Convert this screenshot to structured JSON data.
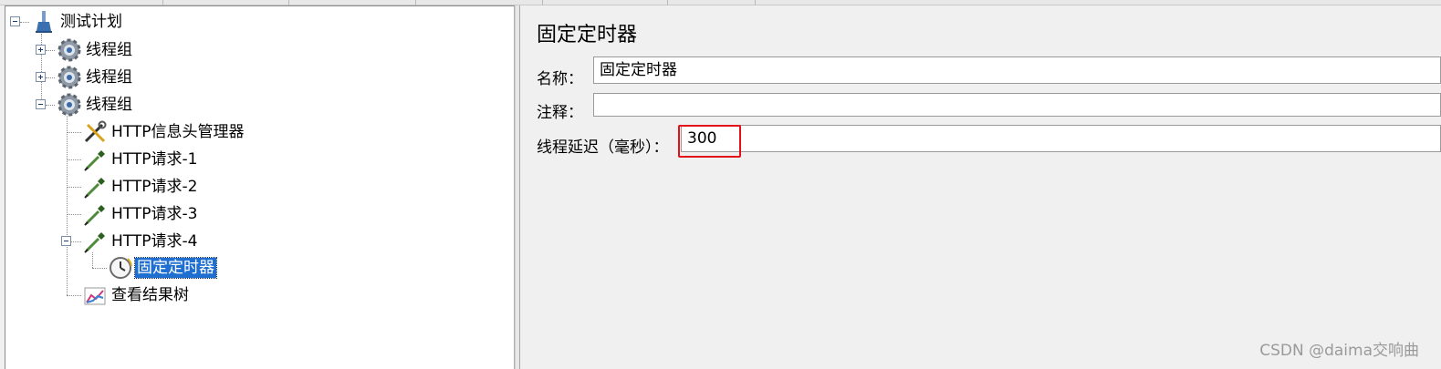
{
  "tree": {
    "root": {
      "label": "测试计划",
      "icon": "test-plan-icon"
    },
    "nodes": [
      {
        "label": "线程组",
        "icon": "gear-icon"
      },
      {
        "label": "线程组",
        "icon": "gear-icon"
      },
      {
        "label": "线程组",
        "icon": "gear-icon"
      },
      {
        "label": "HTTP信息头管理器",
        "icon": "tools-icon"
      },
      {
        "label": "HTTP请求-1",
        "icon": "pipette-icon"
      },
      {
        "label": "HTTP请求-2",
        "icon": "pipette-icon"
      },
      {
        "label": "HTTP请求-3",
        "icon": "pipette-icon"
      },
      {
        "label": "HTTP请求-4",
        "icon": "pipette-icon"
      },
      {
        "label": "固定定时器",
        "icon": "timer-icon"
      },
      {
        "label": "查看结果树",
        "icon": "chart-icon"
      }
    ]
  },
  "panel": {
    "title": "固定定时器",
    "name_label": "名称：",
    "name_value": "固定定时器",
    "comment_label": "注释：",
    "comment_value": "",
    "delay_label": "线程延迟（毫秒）：",
    "delay_value": "300"
  },
  "watermark": "CSDN @daima交响曲",
  "colors": {
    "selection": "#1e6fd0",
    "highlight_box": "#e3101a"
  }
}
